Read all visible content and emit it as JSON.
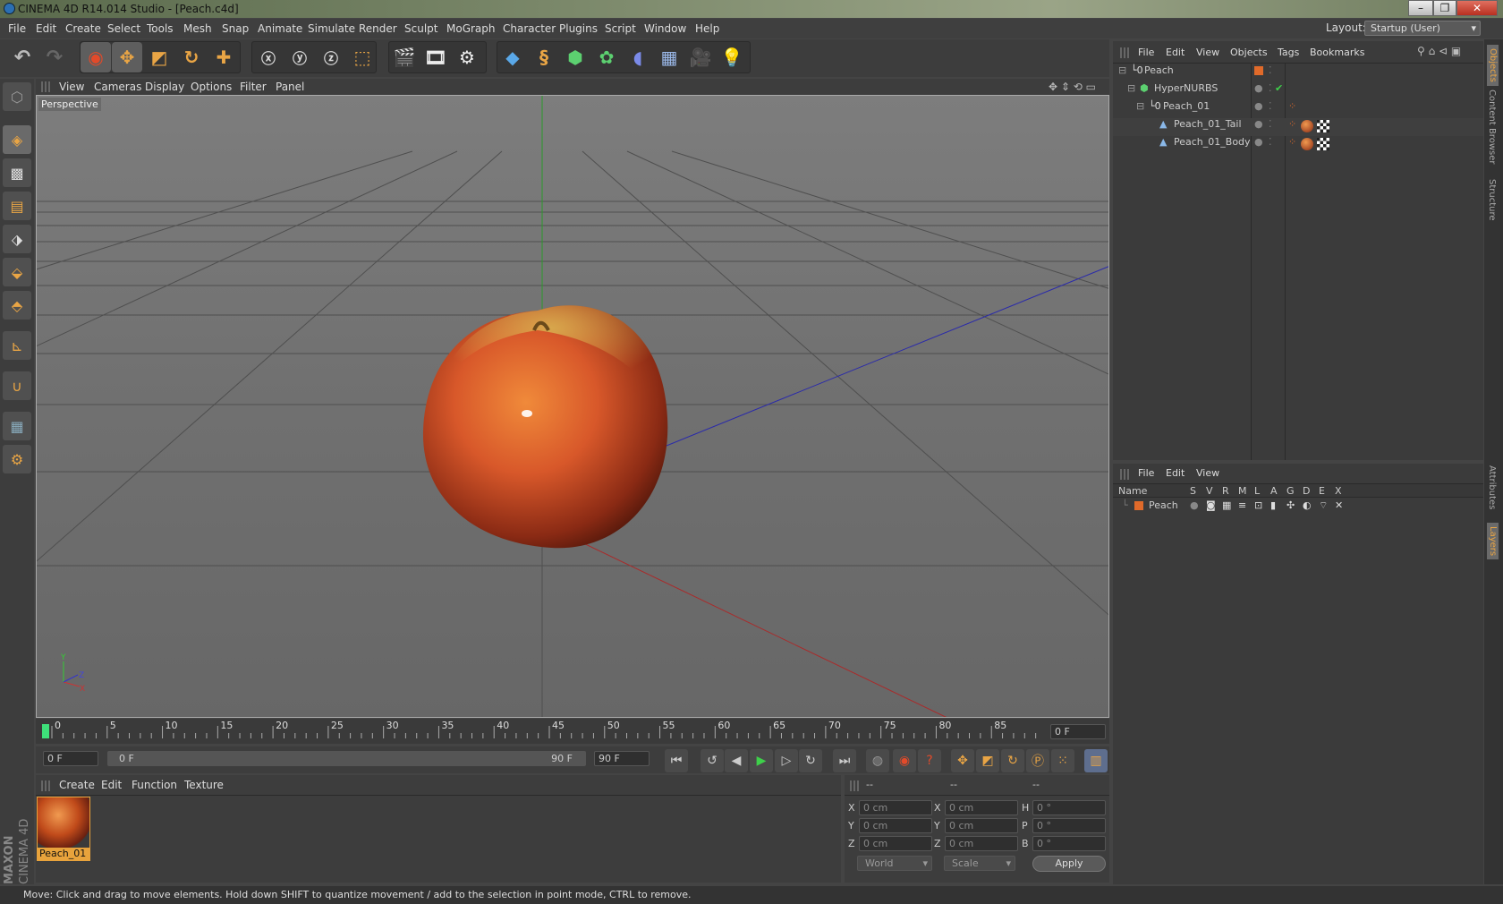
{
  "app": {
    "title": "CINEMA 4D R14.014 Studio - [Peach.c4d]"
  },
  "menubar": [
    "File",
    "Edit",
    "Create",
    "Select",
    "Tools",
    "Mesh",
    "Snap",
    "Animate",
    "Simulate",
    "Render",
    "Sculpt",
    "MoGraph",
    "Character",
    "Plugins",
    "Script",
    "Window",
    "Help"
  ],
  "layout": {
    "label": "Layout:",
    "value": "Startup (User)"
  },
  "viewport": {
    "menu": [
      "View",
      "Cameras",
      "Display",
      "Options",
      "Filter",
      "Panel"
    ],
    "camera_label": "Perspective"
  },
  "timeline": {
    "ticks": [
      "0",
      "5",
      "10",
      "15",
      "20",
      "25",
      "30",
      "35",
      "40",
      "45",
      "50",
      "55",
      "60",
      "65",
      "70",
      "75",
      "80",
      "85",
      "90"
    ],
    "current_frame": "0 F",
    "start_field": "0 F",
    "range_start": "0 F",
    "range_end": "90 F",
    "end_field": "90 F"
  },
  "material_manager": {
    "menu": [
      "Create",
      "Edit",
      "Function",
      "Texture"
    ],
    "material_name": "Peach_01"
  },
  "coordinates": {
    "headers": [
      "--",
      "--",
      "--"
    ],
    "rows": [
      {
        "a": "X",
        "av": "0 cm",
        "b": "X",
        "bv": "0 cm",
        "c": "H",
        "cv": "0 °"
      },
      {
        "a": "Y",
        "av": "0 cm",
        "b": "Y",
        "bv": "0 cm",
        "c": "P",
        "cv": "0 °"
      },
      {
        "a": "Z",
        "av": "0 cm",
        "b": "Z",
        "bv": "0 cm",
        "c": "B",
        "cv": "0 °"
      }
    ],
    "world": "World",
    "scale": "Scale",
    "apply": "Apply"
  },
  "object_manager": {
    "menu": [
      "File",
      "Edit",
      "View",
      "Objects",
      "Tags",
      "Bookmarks"
    ],
    "objects": [
      {
        "name": "Peach",
        "icon": "null-icon"
      },
      {
        "name": "HyperNURBS",
        "icon": "hypernurbs-icon"
      },
      {
        "name": "Peach_01",
        "icon": "null-icon"
      },
      {
        "name": "Peach_01_Tail",
        "icon": "polygon-icon"
      },
      {
        "name": "Peach_01_Body",
        "icon": "polygon-icon"
      }
    ]
  },
  "layer_manager": {
    "menu": [
      "File",
      "Edit",
      "View"
    ],
    "columns": [
      "Name",
      "S",
      "V",
      "R",
      "M",
      "L",
      "A",
      "G",
      "D",
      "E",
      "X"
    ],
    "layers": [
      {
        "name": "Peach"
      }
    ]
  },
  "side_tabs": [
    "Objects",
    "Content Browser",
    "Structure",
    "Attributes",
    "Layers"
  ],
  "brand": {
    "maxon": "MAXON",
    "product": "CINEMA 4D"
  },
  "status": "Move: Click and drag to move elements. Hold down SHIFT to quantize movement / add to the selection in point mode, CTRL to remove.",
  "colors": {
    "accent": "#e8a33c",
    "selection": "#f0a020",
    "bg": "#3d3d3d"
  }
}
